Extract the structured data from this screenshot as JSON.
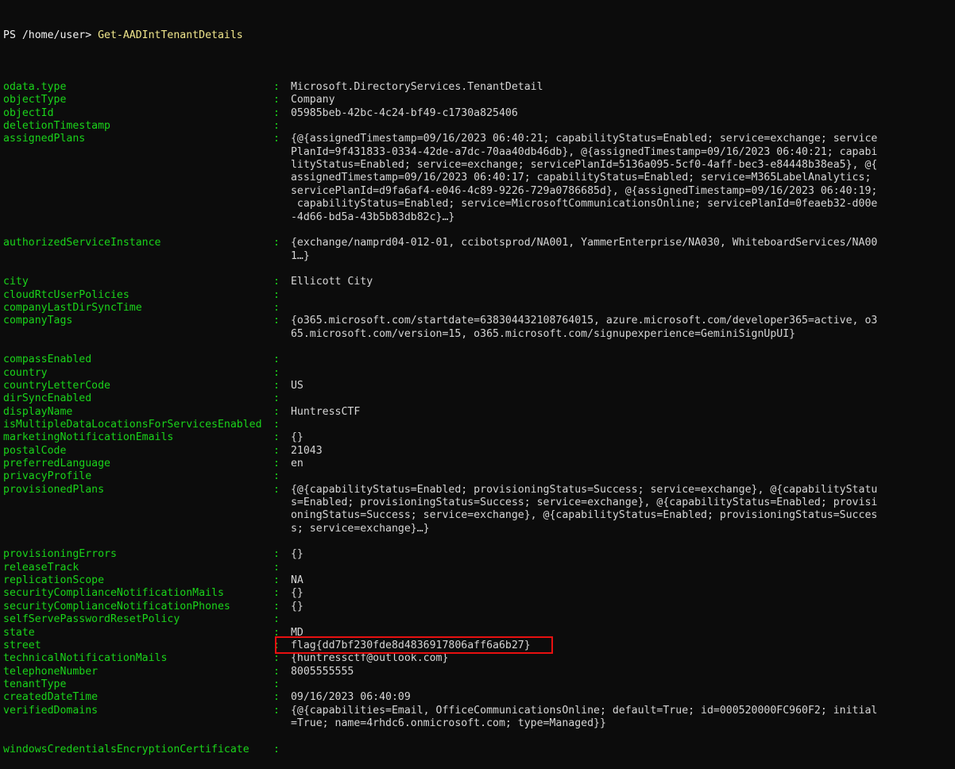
{
  "terminal": {
    "prompt": "PS /home/user> ",
    "command": "Get-AADIntTenantDetails",
    "separator": ":",
    "colors": {
      "background": "#0c0c0c",
      "key": "#1ad41a",
      "value": "#d6d6d6",
      "command": "#f0e68c",
      "prompt": "#f2f2f2",
      "highlight": "#e81010"
    }
  },
  "output": {
    "rows": [
      {
        "key": "odata.type",
        "values": [
          "Microsoft.DirectoryServices.TenantDetail"
        ]
      },
      {
        "key": "objectType",
        "values": [
          "Company"
        ]
      },
      {
        "key": "objectId",
        "values": [
          "05985beb-42bc-4c24-bf49-c1730a825406"
        ]
      },
      {
        "key": "deletionTimestamp",
        "values": [
          ""
        ]
      },
      {
        "key": "assignedPlans",
        "values": [
          "{@{assignedTimestamp=09/16/2023 06:40:21; capabilityStatus=Enabled; service=exchange; service",
          "PlanId=9f431833-0334-42de-a7dc-70aa40db46db}, @{assignedTimestamp=09/16/2023 06:40:21; capabi",
          "lityStatus=Enabled; service=exchange; servicePlanId=5136a095-5cf0-4aff-bec3-e84448b38ea5}, @{",
          "assignedTimestamp=09/16/2023 06:40:17; capabilityStatus=Enabled; service=M365LabelAnalytics;",
          "servicePlanId=d9fa6af4-e046-4c89-9226-729a0786685d}, @{assignedTimestamp=09/16/2023 06:40:19;",
          " capabilityStatus=Enabled; service=MicrosoftCommunicationsOnline; servicePlanId=0feaeb32-d00e",
          "-4d66-bd5a-43b5b83db82c}…}"
        ]
      },
      {
        "key": "authorizedServiceInstance",
        "values": [
          "{exchange/namprd04-012-01, ccibotsprod/NA001, YammerEnterprise/NA030, WhiteboardServices/NA00",
          "1…}"
        ]
      },
      {
        "key": "city",
        "values": [
          "Ellicott City"
        ]
      },
      {
        "key": "cloudRtcUserPolicies",
        "values": [
          ""
        ]
      },
      {
        "key": "companyLastDirSyncTime",
        "values": [
          ""
        ]
      },
      {
        "key": "companyTags",
        "values": [
          "{o365.microsoft.com/startdate=638304432108764015, azure.microsoft.com/developer365=active, o3",
          "65.microsoft.com/version=15, o365.microsoft.com/signupexperience=GeminiSignUpUI}"
        ]
      },
      {
        "key": "compassEnabled",
        "values": [
          ""
        ]
      },
      {
        "key": "country",
        "values": [
          ""
        ]
      },
      {
        "key": "countryLetterCode",
        "values": [
          "US"
        ]
      },
      {
        "key": "dirSyncEnabled",
        "values": [
          ""
        ]
      },
      {
        "key": "displayName",
        "values": [
          "HuntressCTF"
        ]
      },
      {
        "key": "isMultipleDataLocationsForServicesEnabled",
        "values": [
          ""
        ]
      },
      {
        "key": "marketingNotificationEmails",
        "values": [
          "{}"
        ]
      },
      {
        "key": "postalCode",
        "values": [
          "21043"
        ]
      },
      {
        "key": "preferredLanguage",
        "values": [
          "en"
        ]
      },
      {
        "key": "privacyProfile",
        "values": [
          ""
        ]
      },
      {
        "key": "provisionedPlans",
        "values": [
          "{@{capabilityStatus=Enabled; provisioningStatus=Success; service=exchange}, @{capabilityStatu",
          "s=Enabled; provisioningStatus=Success; service=exchange}, @{capabilityStatus=Enabled; provisi",
          "oningStatus=Success; service=exchange}, @{capabilityStatus=Enabled; provisioningStatus=Succes",
          "s; service=exchange}…}"
        ]
      },
      {
        "key": "provisioningErrors",
        "values": [
          "{}"
        ]
      },
      {
        "key": "releaseTrack",
        "values": [
          ""
        ]
      },
      {
        "key": "replicationScope",
        "values": [
          "NA"
        ]
      },
      {
        "key": "securityComplianceNotificationMails",
        "values": [
          "{}"
        ]
      },
      {
        "key": "securityComplianceNotificationPhones",
        "values": [
          "{}"
        ]
      },
      {
        "key": "selfServePasswordResetPolicy",
        "values": [
          ""
        ]
      },
      {
        "key": "state",
        "values": [
          "MD"
        ]
      },
      {
        "key": "street",
        "values": [
          "flag{dd7bf230fde8d4836917806aff6a6b27}"
        ],
        "highlighted": true
      },
      {
        "key": "technicalNotificationMails",
        "values": [
          "{huntressctf@outlook.com}"
        ]
      },
      {
        "key": "telephoneNumber",
        "values": [
          "8005555555"
        ]
      },
      {
        "key": "tenantType",
        "values": [
          ""
        ]
      },
      {
        "key": "createdDateTime",
        "values": [
          "09/16/2023 06:40:09"
        ]
      },
      {
        "key": "verifiedDomains",
        "values": [
          "{@{capabilities=Email, OfficeCommunicationsOnline; default=True; id=000520000FC960F2; initial",
          "=True; name=4rhdc6.onmicrosoft.com; type=Managed}}"
        ]
      },
      {
        "key": "windowsCredentialsEncryptionCertificate",
        "values": [
          ""
        ]
      }
    ]
  }
}
